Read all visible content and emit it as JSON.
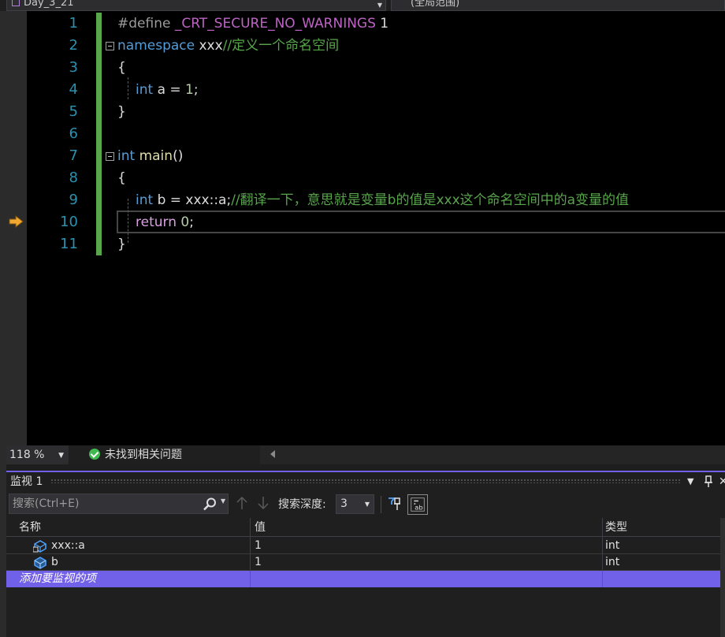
{
  "nav": {
    "project": "Day_3_21",
    "scope": "(全局范围)"
  },
  "editor": {
    "line_numbers": [
      "1",
      "2",
      "3",
      "4",
      "5",
      "6",
      "7",
      "8",
      "9",
      "10",
      "11"
    ],
    "lines": {
      "l1_directive": "#define",
      "l1_macro": " _CRT_SECURE_NO_WARNINGS",
      "l1_value": " 1",
      "l2_keyword": "namespace",
      "l2_name": " xxx",
      "l2_comment": "//定义一个命名空间",
      "l3": "{",
      "l4_type": "int",
      "l4_rest": " a = ",
      "l4_num": "1",
      "l4_end": ";",
      "l5": "}",
      "l7_type": "int",
      "l7_func": " main",
      "l7_rest": "()",
      "l8": "{",
      "l9_type": "int",
      "l9_rest": " b = xxx::a;",
      "l9_comment": "//翻译一下，意思就是变量b的值是xxx这个命名空间中的a变量的值",
      "l10_keyword": "return",
      "l10_num": " 0",
      "l10_end": ";",
      "l11": "}"
    },
    "colors": {
      "line_number": "#2b91af",
      "keyword": "#569cd6",
      "control_keyword": "#d8a0df",
      "comment": "#57a64a",
      "change_bar": "#57a64a",
      "exec_arrow": "#f0a830"
    }
  },
  "status": {
    "zoom": "118 %",
    "issues": "未找到相关问题"
  },
  "watch": {
    "title": "监视 1",
    "search_placeholder": "搜索(Ctrl+E)",
    "depth_label": "搜索深度:",
    "depth_value": "3",
    "columns": {
      "name": "名称",
      "value": "值",
      "type": "类型"
    },
    "rows": [
      {
        "name": "xxx::a",
        "value": "1",
        "type": "int"
      },
      {
        "name": "b",
        "value": "1",
        "type": "int"
      }
    ],
    "add_row": "添加要监视的项",
    "accent": "#7160e8"
  }
}
